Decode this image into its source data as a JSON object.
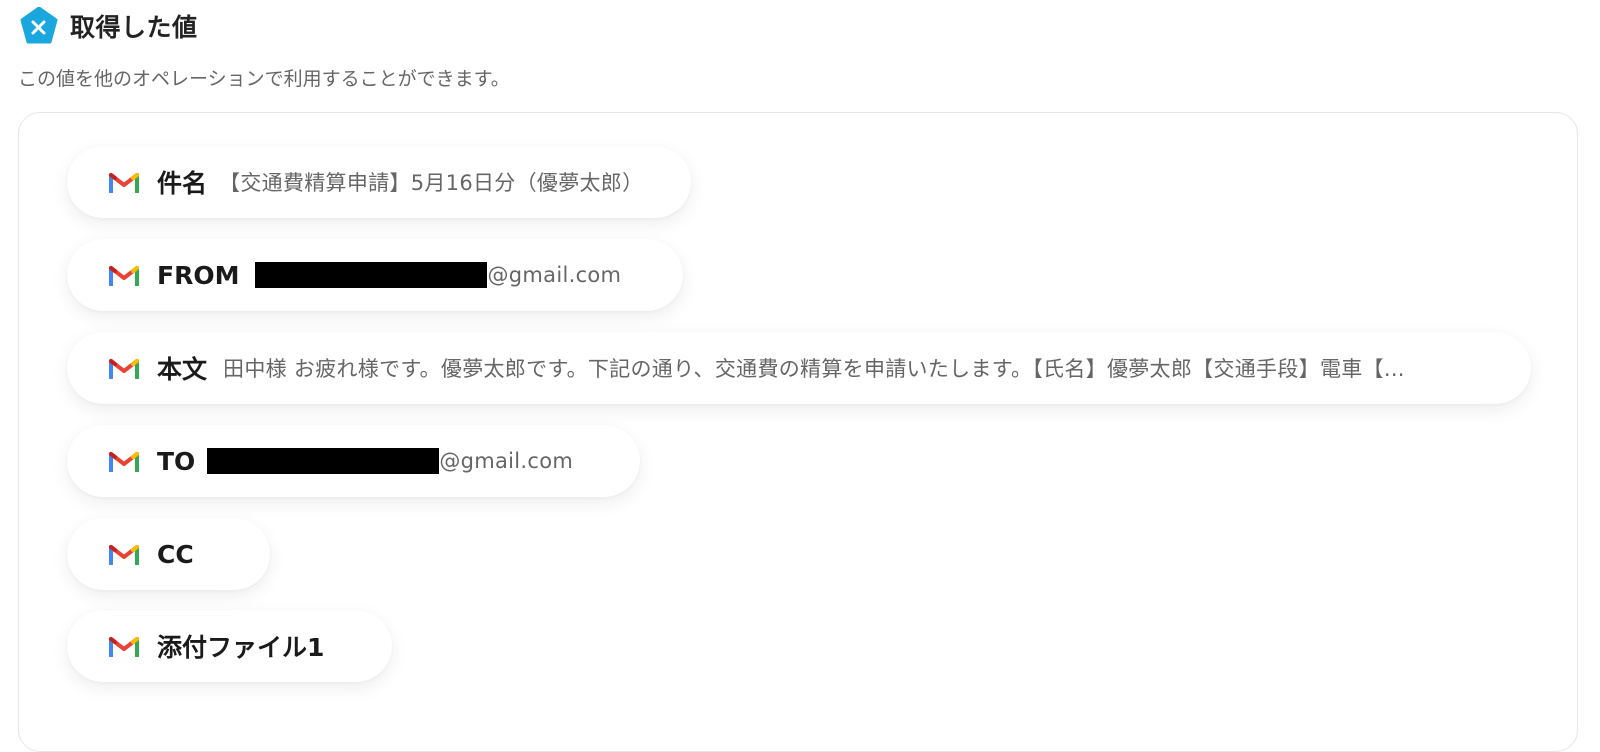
{
  "header": {
    "title": "取得した値",
    "subtitle": "この値を他のオペレーションで利用することができます。"
  },
  "colors": {
    "accent": "#1aa7dd",
    "gmail_red": "#ea4335",
    "gmail_blue": "#4285f4",
    "gmail_green": "#34a853",
    "gmail_yellow": "#fbbc04",
    "redaction": "#000000"
  },
  "fields": [
    {
      "icon": "gmail-icon",
      "label": "件名",
      "value": "【交通費精算申請】5月16日分（優夢太郎）"
    },
    {
      "icon": "gmail-icon",
      "label": "FROM",
      "value": "@gmail.com",
      "redacted": true
    },
    {
      "icon": "gmail-icon",
      "label": "本文",
      "value": "田中様 お疲れ様です。優夢太郎です。下記の通り、交通費の精算を申請いたします。【氏名】優夢太郎【交通手段】電車【..."
    },
    {
      "icon": "gmail-icon",
      "label": "TO",
      "value": "@gmail.com",
      "redacted": true
    },
    {
      "icon": "gmail-icon",
      "label": "CC",
      "value": ""
    },
    {
      "icon": "gmail-icon",
      "label": "添付ファイル1",
      "value": ""
    }
  ]
}
